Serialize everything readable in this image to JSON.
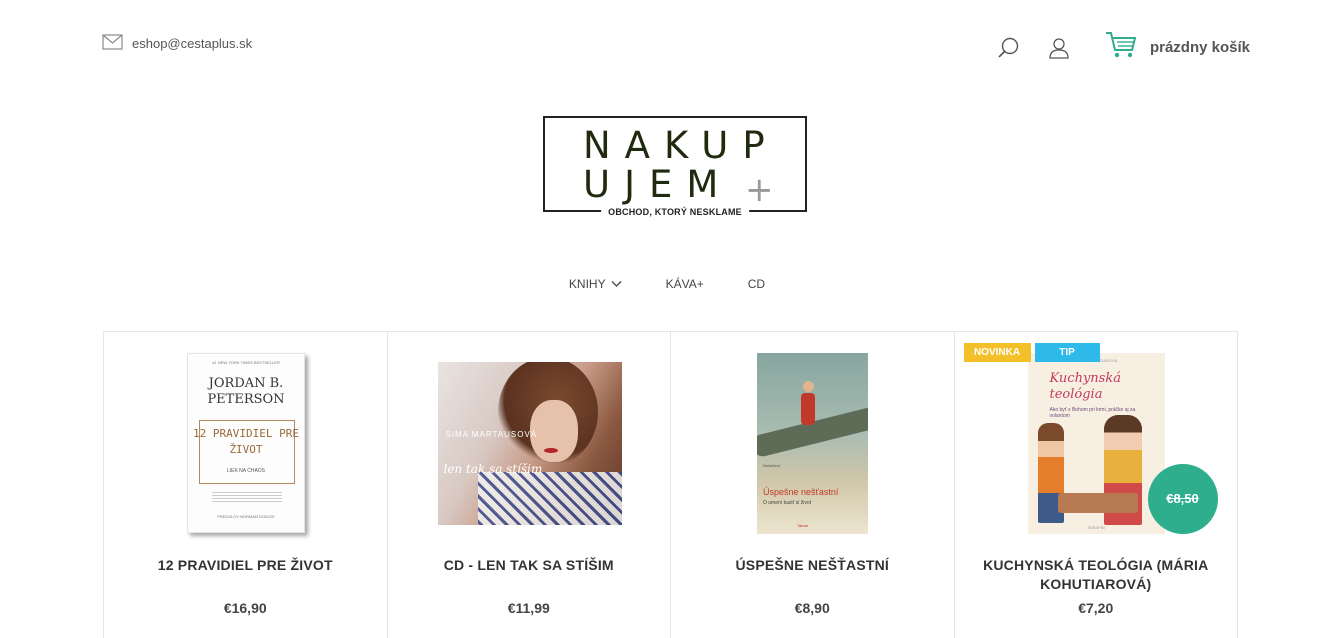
{
  "header": {
    "email": "eshop@cestaplus.sk",
    "cart_label": "prázdny košík",
    "icons": [
      "mail-icon",
      "search-icon",
      "user-icon",
      "cart-icon"
    ],
    "accent": "#2fae8d"
  },
  "logo": {
    "line1": "NAKUP",
    "line2": "UJEM",
    "plus": "+",
    "tagline": "OBCHOD, KTORÝ NESKLAME"
  },
  "nav": {
    "items": [
      {
        "label": "KNIHY",
        "has_dropdown": true
      },
      {
        "label": "KÁVA+"
      },
      {
        "label": "CD"
      }
    ]
  },
  "products": [
    {
      "title": "12 PRAVIDIEL PRE ŽIVOT",
      "price": "€16,90",
      "cover": {
        "top": "#1 NEW YORK TIMES BESTSELLER",
        "author": "JORDAN B. PETERSON",
        "title": "12 PRAVIDIEL PRE ŽIVOT",
        "subtitle": "LIEK NA CHAOS",
        "footer": "PREDSLOV NORMAN DOIDGE"
      }
    },
    {
      "title": "CD - LEN TAK SA STÍŠIM",
      "price": "€11,99",
      "cover": {
        "artist": "SIMA MARTAUSOVÁ",
        "script": "len tak sa stíšim"
      }
    },
    {
      "title": "ÚSPEŠNE NEŠŤASTNÍ",
      "price": "€8,90",
      "cover": {
        "publisher": "Neisešrai",
        "title": "Úspešne nešťastní",
        "subtitle": "O umení kaziť si život",
        "imprint": "Tatran"
      }
    },
    {
      "title": "KUCHYNSKÁ TEOLÓGIA (MÁRIA KOHUTIAROVÁ)",
      "price": "€7,20",
      "old_price": "€8,50",
      "badges": [
        "NOVINKA",
        "TIP"
      ],
      "cover": {
        "author": "MÁRIA KOHUTIAROVÁ",
        "title": "Kuchynská teológia",
        "subtitle": "Ako byť s Bohom pri krmi, práčke aj za volantom",
        "publisher": "SERAFÍN"
      }
    }
  ]
}
